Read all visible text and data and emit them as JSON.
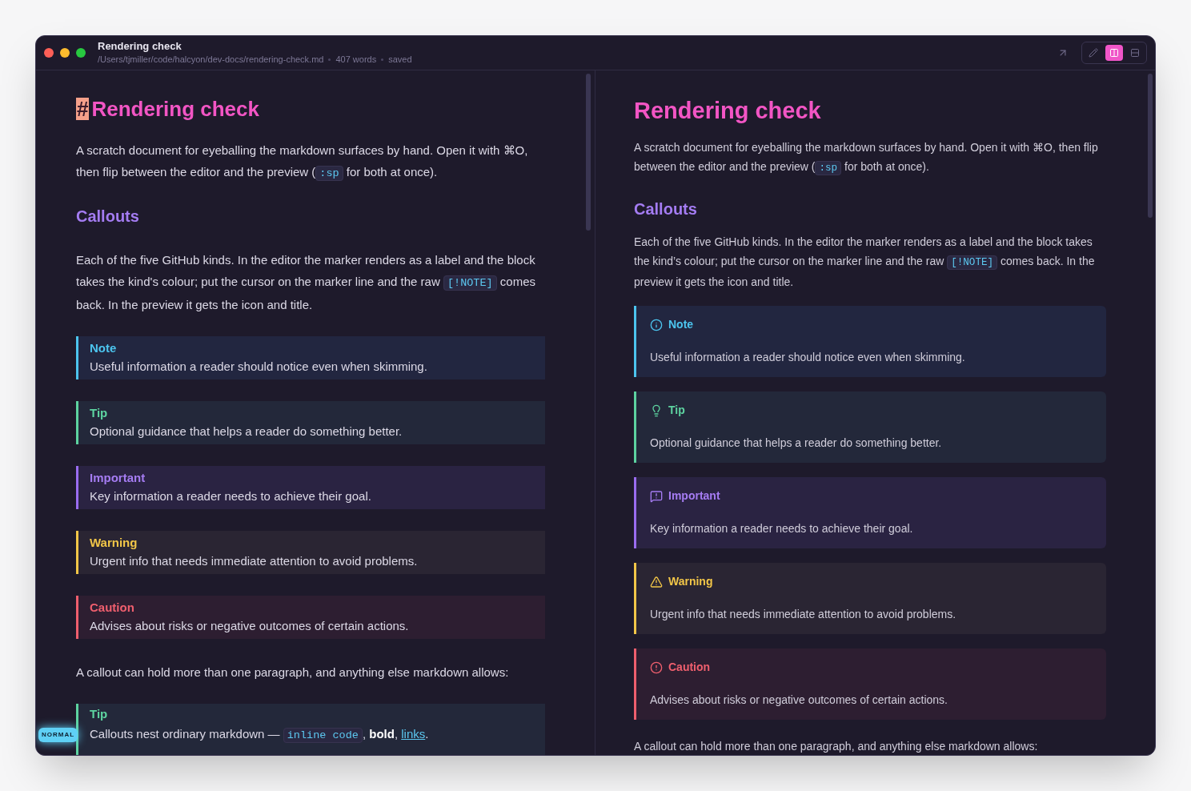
{
  "window": {
    "title": "Rendering check",
    "path": "/Users/tjmiller/code/halcyon/dev-docs/rendering-check.md",
    "word_count": "407 words",
    "save_state": "saved"
  },
  "view_modes": [
    {
      "kind": "edit",
      "selected": false
    },
    {
      "kind": "split",
      "selected": true
    },
    {
      "kind": "preview",
      "selected": false
    }
  ],
  "editor": {
    "heading_marker": "#",
    "title": "Rendering check",
    "intro": [
      {
        "text": "A scratch document for eyeballing the markdown surfaces by hand. Open it with ⌘O, then flip between the editor and the preview ("
      },
      {
        "code": ":sp"
      },
      {
        "text": " for both at once)."
      }
    ],
    "section": "Callouts",
    "section_text": [
      {
        "text": "Each of the five GitHub kinds. In the editor the marker renders as a label and the block takes the kind's colour; put the cursor on the marker line and the raw "
      },
      {
        "code": "[!NOTE]"
      },
      {
        "text": " comes back. In the preview it gets the icon and title."
      }
    ],
    "callouts": [
      {
        "kind": "note",
        "title": "Note",
        "body": "Useful information a reader should notice even when skimming."
      },
      {
        "kind": "tip",
        "title": "Tip",
        "body": "Optional guidance that helps a reader do something better."
      },
      {
        "kind": "important",
        "title": "Important",
        "body": "Key information a reader needs to achieve their goal."
      },
      {
        "kind": "warning",
        "title": "Warning",
        "body": "Urgent info that needs immediate attention to avoid problems."
      },
      {
        "kind": "caution",
        "title": "Caution",
        "body": "Advises about risks or negative outcomes of certain actions."
      }
    ],
    "after_text": "A callout can hold more than one paragraph, and anything else markdown allows:",
    "nested_callout": {
      "kind": "tip",
      "title": "Tip",
      "body": [
        {
          "text": "Callouts nest ordinary markdown — "
        },
        {
          "code": "inline code"
        },
        {
          "text": ", **bold**, "
        },
        {
          "link": "links"
        },
        {
          "text": "."
        }
      ]
    },
    "mode": "NORMAL"
  },
  "preview": {
    "title": "Rendering check",
    "intro": [
      {
        "text": "A scratch document for eyeballing the markdown surfaces by hand. Open it with ⌘O, then flip between the editor and the preview ("
      },
      {
        "code": ":sp"
      },
      {
        "text": " for both at once)."
      }
    ],
    "section": "Callouts",
    "section_text": [
      {
        "text": "Each of the five GitHub kinds. In the editor the marker renders as a label and the block takes the kind’s colour; put the cursor on the marker line and the raw "
      },
      {
        "code": "[!NOTE]"
      },
      {
        "text": " comes back. In the preview it gets the icon and title."
      }
    ],
    "callouts": [
      {
        "kind": "note",
        "title": "Note",
        "body": "Useful information a reader should notice even when skimming."
      },
      {
        "kind": "tip",
        "title": "Tip",
        "body": "Optional guidance that helps a reader do something better."
      },
      {
        "kind": "important",
        "title": "Important",
        "body": "Key information a reader needs to achieve their goal."
      },
      {
        "kind": "warning",
        "title": "Warning",
        "body": "Urgent info that needs immediate attention to avoid problems."
      },
      {
        "kind": "caution",
        "title": "Caution",
        "body": "Advises about risks or negative outcomes of certain actions."
      }
    ],
    "after_text": "A callout can hold more than one paragraph, and anything else markdown allows:"
  }
}
